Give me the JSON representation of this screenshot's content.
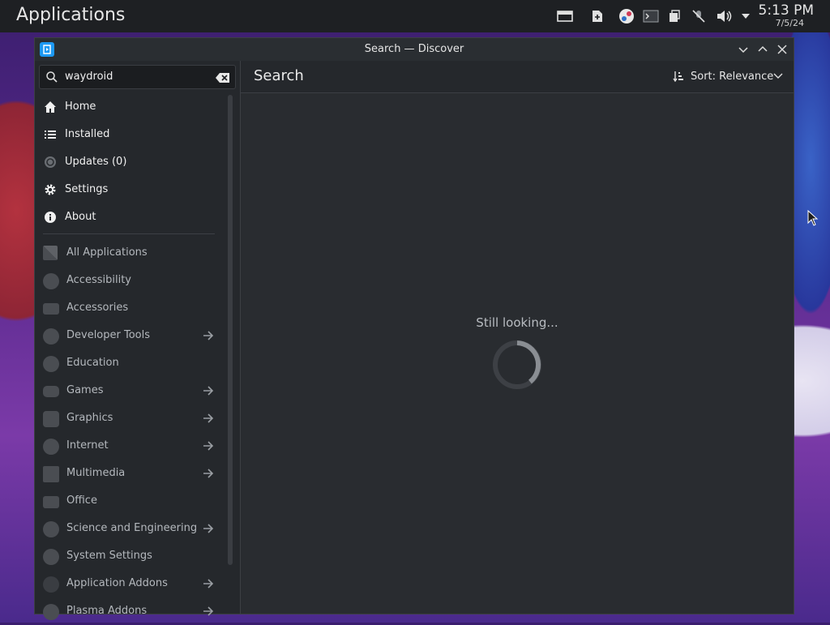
{
  "panel": {
    "title": "Applications",
    "clock_time": "5:13 PM",
    "clock_date": "7/5/24"
  },
  "window": {
    "title": "Search — Discover"
  },
  "search": {
    "value": "waydroid"
  },
  "sidebar": {
    "nav": [
      {
        "label": "Home",
        "icon": "home-icon"
      },
      {
        "label": "Installed",
        "icon": "list-icon"
      },
      {
        "label": "Updates (0)",
        "icon": "updates-icon"
      },
      {
        "label": "Settings",
        "icon": "gear-icon"
      },
      {
        "label": "About",
        "icon": "info-icon"
      }
    ],
    "categories": [
      {
        "label": "All Applications"
      },
      {
        "label": "Accessibility"
      },
      {
        "label": "Accessories"
      },
      {
        "label": "Developer Tools"
      },
      {
        "label": "Education"
      },
      {
        "label": "Games"
      },
      {
        "label": "Graphics"
      },
      {
        "label": "Internet"
      },
      {
        "label": "Multimedia"
      },
      {
        "label": "Office"
      },
      {
        "label": "Science and Engineering"
      },
      {
        "label": "System Settings"
      },
      {
        "label": "Application Addons"
      },
      {
        "label": "Plasma Addons"
      }
    ]
  },
  "main": {
    "title": "Search",
    "sort_label": "Sort: Relevance",
    "status": "Still looking..."
  },
  "colors": {
    "accent": "#1d99f3",
    "panel_bg": "#1e2023",
    "window_bg": "#292c30"
  }
}
